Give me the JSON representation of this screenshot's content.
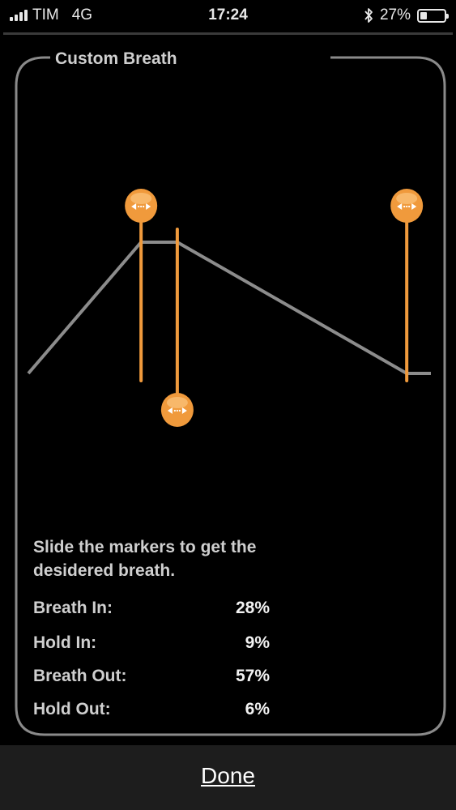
{
  "status_bar": {
    "carrier": "TIM",
    "network": "4G",
    "time": "17:24",
    "bluetooth_icon": "bluetooth-icon",
    "battery": "27%",
    "battery_level": 0.27
  },
  "card": {
    "title": "Custom Breath"
  },
  "chart_data": {
    "type": "line",
    "title": "",
    "segments": [
      {
        "name": "Breath In",
        "percent": 28
      },
      {
        "name": "Hold In",
        "percent": 9
      },
      {
        "name": "Breath Out",
        "percent": 57
      },
      {
        "name": "Hold Out",
        "percent": 6
      }
    ],
    "markers": 3,
    "line_color": "#8c8c8c",
    "marker_color": "#f09a3c",
    "handle_icon": "left-right-arrows-icon"
  },
  "instructions": "Slide the markers to get the desidered breath.",
  "stats": [
    {
      "label": "Breath In:",
      "value": "28%"
    },
    {
      "label": "Hold In:",
      "value": "9%"
    },
    {
      "label": "Breath Out:",
      "value": "57%"
    },
    {
      "label": "Hold Out:",
      "value": "6%"
    }
  ],
  "done_label": "Done",
  "colors": {
    "accent": "#f09a3c",
    "frame": "#8a8a8a",
    "background": "#000000"
  }
}
